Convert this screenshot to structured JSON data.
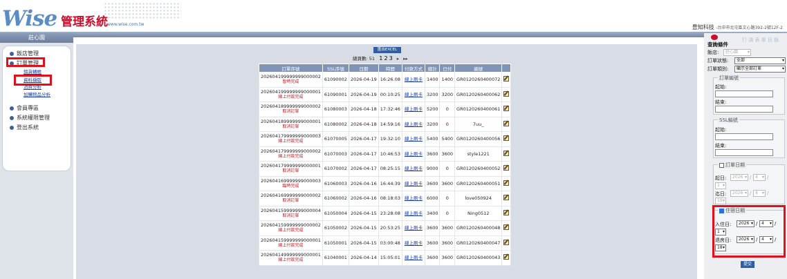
{
  "header": {
    "logo": "Wise",
    "title": "管理系統",
    "url": "www.wise.com.tw",
    "company": "豊知科技",
    "address": "-台中市北屯區文心路392-2號12F-2"
  },
  "sidebar": {
    "header": "莊心園",
    "menu": [
      {
        "label": "飯店管理"
      },
      {
        "label": "訂單管理"
      },
      {
        "label": "會員專區"
      },
      {
        "label": "系統權限管理"
      },
      {
        "label": "登出系統"
      }
    ],
    "sub": [
      "銷貨轉帳",
      "資料擷取",
      "消費分析",
      "加購物品分析"
    ]
  },
  "main": {
    "excel_label": "匯出EXCEL",
    "pager_label": "總頁數:",
    "pager_total": "51",
    "pages": [
      "1",
      "2",
      "3"
    ],
    "next": "▸",
    "last": "▸▸",
    "columns": [
      "訂單序號",
      "SSL序號",
      "日期",
      "時間",
      "付款方式",
      "總計",
      "已付",
      "編號",
      ""
    ],
    "rows": [
      {
        "id": "202604199999999000002",
        "status": "暫時完成",
        "ssl": "61090002",
        "date": "2026-04-19",
        "time": "16:26.08",
        "pay": "線上刷卡",
        "total": "1400",
        "paid": "1400",
        "code": "GR0120260400072"
      },
      {
        "id": "202604199999999000001",
        "status": "線上付款完成",
        "ssl": "61090001",
        "date": "2026-04-19",
        "time": "00:10:25",
        "pay": "線上刷卡",
        "total": "3200",
        "paid": "3200",
        "code": "GR0120260400062"
      },
      {
        "id": "202604189999999000002",
        "status": "取消訂單",
        "ssl": "61080003",
        "date": "2026-04-18",
        "time": "17:32:46",
        "pay": "線上刷卡",
        "total": "5200",
        "paid": "0",
        "code": "GR0120260400061"
      },
      {
        "id": "202604189999999000001",
        "status": "取消訂單",
        "ssl": "61080002",
        "date": "2026-04-18",
        "time": "14:59:16",
        "pay": "線上刷卡",
        "total": "3200",
        "paid": "0",
        "code": "7uu_"
      },
      {
        "id": "202604179999999000003",
        "status": "線上付款完成",
        "ssl": "61070005",
        "date": "2026-04-17",
        "time": "19:32:10",
        "pay": "線上刷卡",
        "total": "5400",
        "paid": "5400",
        "code": "GR0120260400056"
      },
      {
        "id": "202604179999999000002",
        "status": "線上付款完成",
        "ssl": "61070003",
        "date": "2026-04-17",
        "time": "10:46:53",
        "pay": "線上刷卡",
        "total": "3600",
        "paid": "3600",
        "code": "style1221"
      },
      {
        "id": "202604179999999000001",
        "status": "取消訂單",
        "ssl": "61070002",
        "date": "2026-04-17",
        "time": "08:25:15",
        "pay": "線上刷卡",
        "total": "9000",
        "paid": "0",
        "code": "GR0120260400052"
      },
      {
        "id": "202604169999999000003",
        "status": "臨時完成",
        "ssl": "61060003",
        "date": "2026-04-16",
        "time": "16:44:39",
        "pay": "線上刷卡",
        "total": "3600",
        "paid": "3600",
        "code": "GR0120260400051"
      },
      {
        "id": "202604169999999000002",
        "status": "取消訂單",
        "ssl": "61060002",
        "date": "2026-04-16",
        "time": "08:18:03",
        "pay": "線上刷卡",
        "total": "6000",
        "paid": "0",
        "code": "love050924"
      },
      {
        "id": "202604159999999000004",
        "status": "取消訂單",
        "ssl": "61050004",
        "date": "2026-04-15",
        "time": "23:28.08",
        "pay": "線上刷卡",
        "total": "3400",
        "paid": "0",
        "code": "Ning0512"
      },
      {
        "id": "202604159999999000002",
        "status": "線上付款完成",
        "ssl": "61050002",
        "date": "2026-04-15",
        "time": "20:53:25",
        "pay": "線上刷卡",
        "total": "3600",
        "paid": "3600",
        "code": "GR0120260400048"
      },
      {
        "id": "202604159999999000001",
        "status": "線上付款完成",
        "ssl": "61050001",
        "date": "2026-04-15",
        "time": "03:00:48",
        "pay": "線上刷卡",
        "total": "3600",
        "paid": "3600",
        "code": "GR0120260400047"
      },
      {
        "id": "202604149999999000001",
        "status": "線上付款完成",
        "ssl": "61040001",
        "date": "2026-04-14",
        "time": "15:05:01",
        "pay": "線上刷卡",
        "total": "3600",
        "paid": "3600",
        "code": "GR0120260400043"
      }
    ]
  },
  "filter": {
    "title": "查詢條件",
    "ghost": "打 滿 表 單 目 錄",
    "hotel_label": "飯店:",
    "hotel_value": "莊心園",
    "status_label": "訂單狀態:",
    "status_value": "全部",
    "type_label": "訂單類別:",
    "type_value": "顯示全部訂單",
    "order_no_legend": "訂單編號",
    "start_label": "起始:",
    "end_label": "結束:",
    "ssl_legend": "SSL編號",
    "order_date_legend": "訂單日期",
    "od_from_label": "起日:",
    "od_from": [
      "2026",
      "4",
      "1"
    ],
    "od_to_label": "迄日:",
    "od_to": [
      "2026",
      "4",
      "19"
    ],
    "stay_legend": "住宿日期",
    "checkin_label": "入住日:",
    "checkin": [
      "2026",
      "4",
      "1"
    ],
    "checkout_label": "退房日:",
    "checkout": [
      "2026",
      "4",
      "18"
    ],
    "slash": "/",
    "submit": "提交"
  }
}
